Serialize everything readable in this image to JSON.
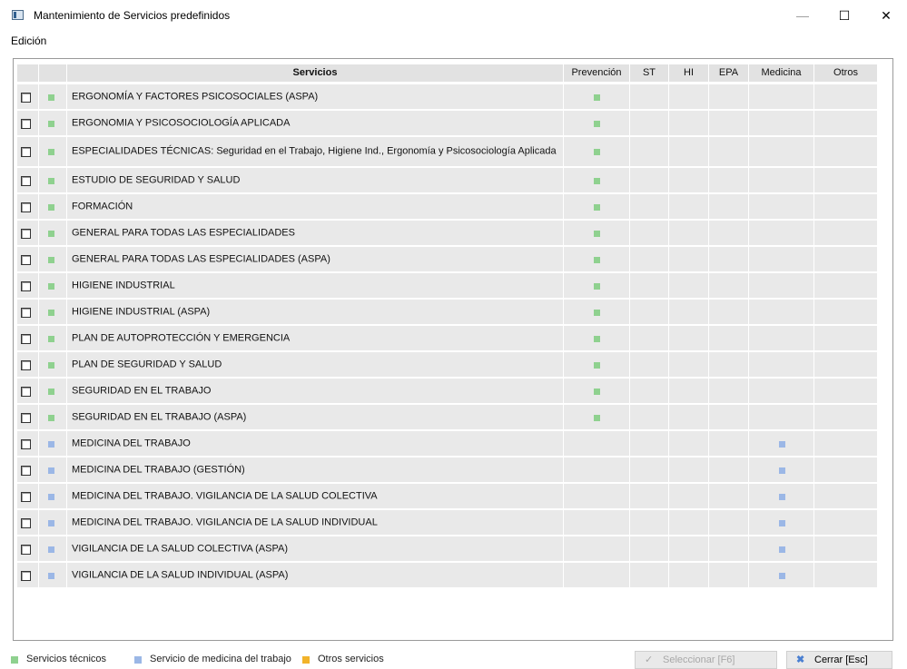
{
  "window": {
    "title": "Mantenimiento de Servicios predefinidos",
    "controls": {
      "minimize": "—",
      "maximize": "☐",
      "close": "✕"
    }
  },
  "menu": [
    "Edición"
  ],
  "table": {
    "columns": [
      "",
      "",
      "Servicios",
      "Prevención",
      "ST",
      "HI",
      "EPA",
      "Medicina",
      "Otros"
    ],
    "rows": [
      {
        "type": "tecnico",
        "name": "ERGONOMÍA Y FACTORES PSICOSOCIALES (ASPA)",
        "prevencion": true,
        "medicina": false
      },
      {
        "type": "tecnico",
        "name": "ERGONOMIA Y PSICOSOCIOLOGÍA APLICADA",
        "prevencion": true,
        "medicina": false
      },
      {
        "type": "tecnico",
        "name": "ESPECIALIDADES TÉCNICAS: Seguridad en el Trabajo, Higiene Ind., Ergonomía y Psicosociología Aplicada",
        "prevencion": true,
        "medicina": false
      },
      {
        "type": "tecnico",
        "name": "ESTUDIO DE SEGURIDAD Y SALUD",
        "prevencion": true,
        "medicina": false
      },
      {
        "type": "tecnico",
        "name": "FORMACIÓN",
        "prevencion": true,
        "medicina": false
      },
      {
        "type": "tecnico",
        "name": "GENERAL PARA TODAS LAS ESPECIALIDADES",
        "prevencion": true,
        "medicina": false
      },
      {
        "type": "tecnico",
        "name": "GENERAL PARA TODAS LAS ESPECIALIDADES (ASPA)",
        "prevencion": true,
        "medicina": false
      },
      {
        "type": "tecnico",
        "name": "HIGIENE INDUSTRIAL",
        "prevencion": true,
        "medicina": false
      },
      {
        "type": "tecnico",
        "name": "HIGIENE INDUSTRIAL (ASPA)",
        "prevencion": true,
        "medicina": false
      },
      {
        "type": "tecnico",
        "name": "PLAN DE AUTOPROTECCIÓN Y EMERGENCIA",
        "prevencion": true,
        "medicina": false
      },
      {
        "type": "tecnico",
        "name": "PLAN DE SEGURIDAD Y SALUD",
        "prevencion": true,
        "medicina": false
      },
      {
        "type": "tecnico",
        "name": "SEGURIDAD EN EL TRABAJO",
        "prevencion": true,
        "medicina": false
      },
      {
        "type": "tecnico",
        "name": "SEGURIDAD EN EL TRABAJO (ASPA)",
        "prevencion": true,
        "medicina": false
      },
      {
        "type": "medicina",
        "name": "MEDICINA DEL TRABAJO",
        "prevencion": false,
        "medicina": true
      },
      {
        "type": "medicina",
        "name": "MEDICINA DEL TRABAJO (GESTIÓN)",
        "prevencion": false,
        "medicina": true
      },
      {
        "type": "medicina",
        "name": "MEDICINA DEL TRABAJO. VIGILANCIA DE LA SALUD COLECTIVA",
        "prevencion": false,
        "medicina": true
      },
      {
        "type": "medicina",
        "name": "MEDICINA DEL TRABAJO. VIGILANCIA DE LA SALUD INDIVIDUAL",
        "prevencion": false,
        "medicina": true
      },
      {
        "type": "medicina",
        "name": "VIGILANCIA DE LA SALUD COLECTIVA (ASPA)",
        "prevencion": false,
        "medicina": true
      },
      {
        "type": "medicina",
        "name": "VIGILANCIA DE LA SALUD INDIVIDUAL (ASPA)",
        "prevencion": false,
        "medicina": true
      }
    ]
  },
  "legend": [
    {
      "label": "Servicios técnicos",
      "color": "#8fd18f"
    },
    {
      "label": "Servicio de medicina del trabajo",
      "color": "#9bb7e6"
    },
    {
      "label": "Otros servicios",
      "color": "#f2b32a"
    }
  ],
  "buttons": {
    "select": {
      "label": "Seleccionar  [F6]",
      "icon": "check-icon",
      "enabled": false
    },
    "close": {
      "label": "Cerrar  [Esc]",
      "icon": "close-x-icon",
      "enabled": true
    }
  },
  "colors": {
    "tecnico": "#8fd18f",
    "medicina": "#9bb7e6",
    "otros": "#f2b32a",
    "close_x": "#4a7fd1"
  }
}
